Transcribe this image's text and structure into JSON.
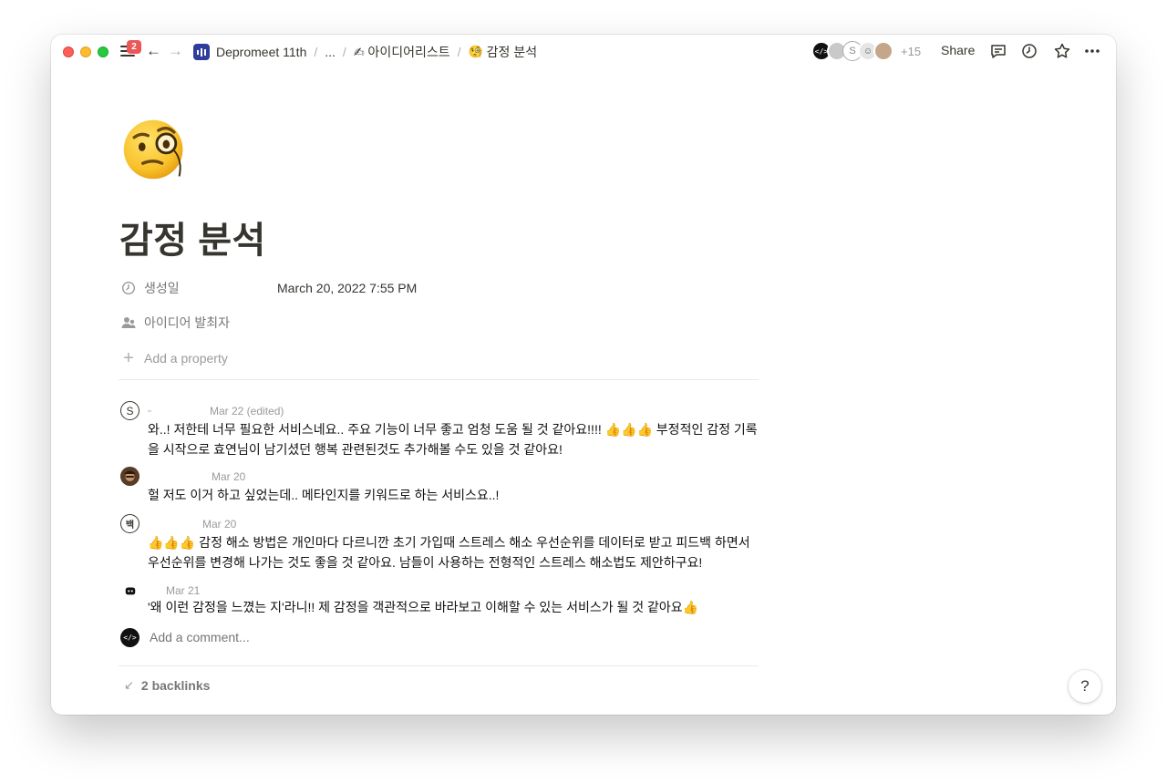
{
  "menu": {
    "badge": "2"
  },
  "breadcrumb": {
    "workspace": "Depromeet 11th",
    "ellipsis": "...",
    "parent": "✍ 아이디어리스트",
    "current_emoji": "🧐",
    "current": "감정 분석"
  },
  "topbar": {
    "more_avatars": "+15",
    "share_label": "Share"
  },
  "page": {
    "title": "감정 분석",
    "icon": "face-with-monocle"
  },
  "properties": [
    {
      "label": "생성일",
      "value": "March 20, 2022 7:55 PM",
      "icon": "clock-icon"
    },
    {
      "label": "아이디어 발최자",
      "value": "",
      "icon": "person-icon"
    }
  ],
  "add_property_label": "Add a property",
  "comments": [
    {
      "avatar": "S",
      "time": "Mar 22 (edited)",
      "text": "와..! 저한테 너무 필요한 서비스네요.. 주요 기능이 너무 좋고 엄청 도움 될 것 같아요!!!! 👍👍👍 부정적인 감정 기록을 시작으로 효연님이 남기셨던 행복 관련된것도 추가해볼 수도 있을 것 같아요!"
    },
    {
      "avatar": "",
      "time": "Mar 20",
      "text": "헐 저도 이거 하고 싶었는데.. 메타인지를 키워드로 하는 서비스요..!"
    },
    {
      "avatar": "백",
      "time": "Mar 20",
      "text": "👍👍👍 감정 해소 방법은 개인마다 다르니깐 초기 가입때 스트레스 해소 우선순위를 데이터로 받고 피드백 하면서 우선순위를 변경해 나가는 것도 좋을 것 같아요. 남들이 사용하는 전형적인 스트레스 해소법도 제안하구요!"
    },
    {
      "avatar": "",
      "time": "Mar 21",
      "text": "'왜 이런 감정을 느꼈는 지'라니!! 제 감정을 객관적으로 바라보고 이해할 수 있는 서비스가 될 것 같아요👍"
    }
  ],
  "comment_input": {
    "placeholder": "Add a comment..."
  },
  "backlinks_label": "2 backlinks",
  "help_label": "?",
  "colors": {
    "text": "#37352f",
    "muted": "#9b9a97",
    "badge": "#eb5757",
    "workspace_logo": "#2f3d9c"
  }
}
